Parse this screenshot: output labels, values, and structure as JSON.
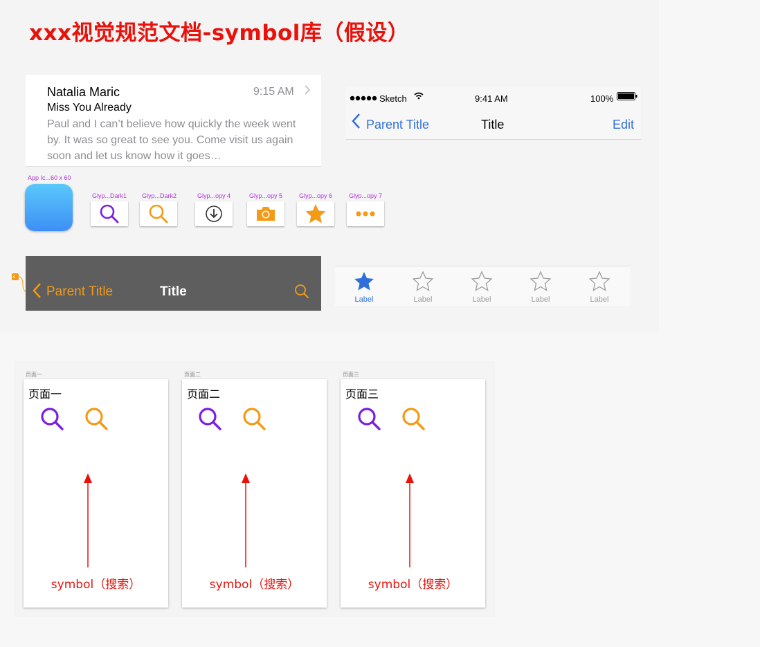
{
  "page_title": "xxx视觉规范文档-symbol库（假设）",
  "mail": {
    "sender": "Natalia Maric",
    "time": "9:15 AM",
    "subject": "Miss You Already",
    "preview": "Paul and I can’t believe how quickly the week went by. It was so great to see you. Come visit us again soon and let us know how it goes…"
  },
  "ios_nav": {
    "carrier": "Sketch",
    "time": "9:41 AM",
    "battery": "100%",
    "back_label": "Parent Title",
    "title": "Title",
    "edit_label": "Edit",
    "accent": "#2f6fdc"
  },
  "symbols": {
    "app_icon_label": "App Ic...60 x 60",
    "glyphs": [
      {
        "label": "Glyp...Dark1",
        "icon": "search-icon",
        "color": "#7a1fe0"
      },
      {
        "label": "Glyp...Dark2",
        "icon": "search-icon",
        "color": "#f39a16"
      },
      {
        "label": "Glyp...opy 4",
        "icon": "download-circle-icon",
        "color": "#333333"
      },
      {
        "label": "Glyp...opy 5",
        "icon": "camera-icon",
        "color": "#f39a16"
      },
      {
        "label": "Glyp...opy 6",
        "icon": "star-icon",
        "color": "#f39a16"
      },
      {
        "label": "Glyp...opy 7",
        "icon": "more-dots-icon",
        "color": "#f39a16"
      }
    ]
  },
  "dark_nav": {
    "back_label": "Parent Title",
    "title": "Title",
    "accent": "#f39a16"
  },
  "tab_bar": {
    "items": [
      {
        "label": "Label",
        "active": true
      },
      {
        "label": "Label",
        "active": false
      },
      {
        "label": "Label",
        "active": false
      },
      {
        "label": "Label",
        "active": false
      },
      {
        "label": "Label",
        "active": false
      }
    ]
  },
  "pages": [
    {
      "small_label": "页面一",
      "heading": "页面一",
      "caption": "symbol（搜索）"
    },
    {
      "small_label": "页面二",
      "heading": "页面二",
      "caption": "symbol（搜索）"
    },
    {
      "small_label": "页面三",
      "heading": "页面三",
      "caption": "symbol（搜索）"
    }
  ]
}
